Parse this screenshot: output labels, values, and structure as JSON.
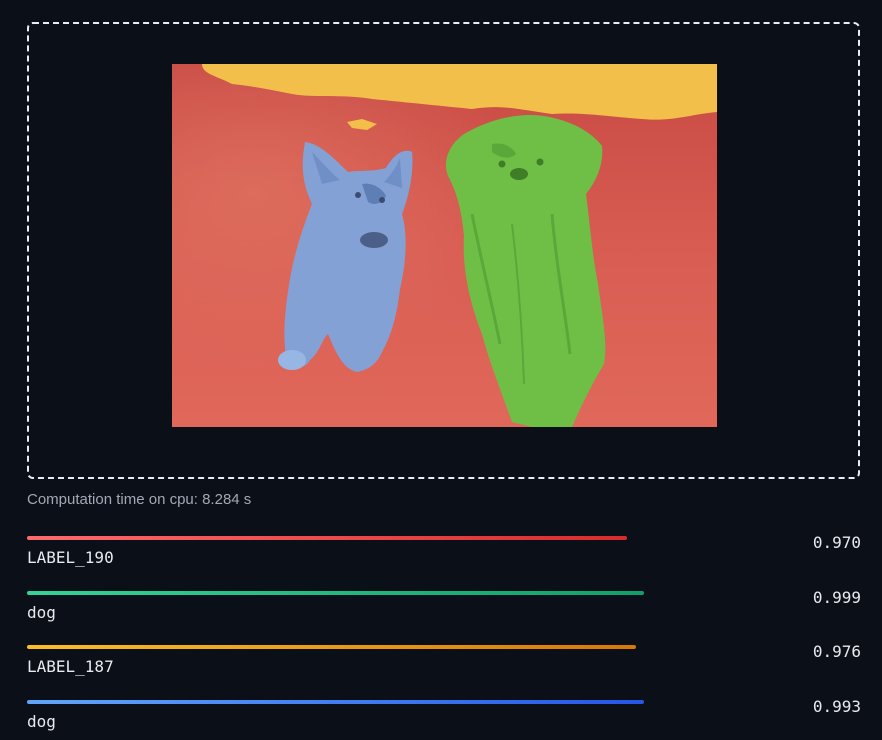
{
  "computation_text": "Computation time on cpu: 8.284 s",
  "results": [
    {
      "label": "LABEL_190",
      "score": "0.970",
      "color_start": "#ff6b6b",
      "color_end": "#d72c2c",
      "fill": 0.72
    },
    {
      "label": "dog",
      "score": "0.999",
      "color_start": "#34d399",
      "color_end": "#129e6b",
      "fill": 0.74
    },
    {
      "label": "LABEL_187",
      "score": "0.976",
      "color_start": "#fbbf24",
      "color_end": "#d97706",
      "fill": 0.73
    },
    {
      "label": "dog",
      "score": "0.993",
      "color_start": "#60a5fa",
      "color_end": "#2557e6",
      "fill": 0.74
    }
  ],
  "segmentation_colors": {
    "background": "#d9534f",
    "sky": "#f4c84a",
    "dog_left": "#7ea6e0",
    "dog_right": "#6fc24b"
  }
}
